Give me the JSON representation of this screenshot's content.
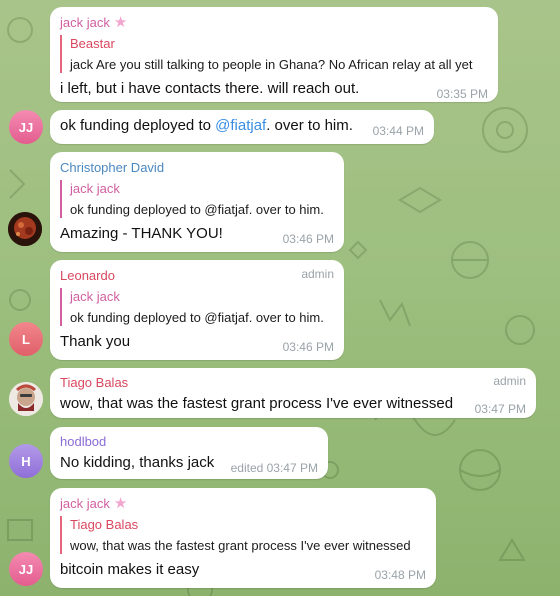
{
  "theme": {
    "accent": "#3a8ee6",
    "bubble_bg": "#ffffff",
    "wallpaper": "#9dbf7f"
  },
  "messages": [
    {
      "sender": "jack jack",
      "sender_badge": "star-icon",
      "reply_to": {
        "name": "Beastar",
        "text": "jack Are you still talking to people in Ghana? No African relay at all yet"
      },
      "text": "i left, but i have contacts there. will reach out.",
      "time": "03:35 PM"
    },
    {
      "avatar_initials": "JJ",
      "text_prefix": "ok funding deployed to ",
      "mention": "@fiatjaf",
      "text_suffix": ". over to him.",
      "time": "03:44 PM"
    },
    {
      "sender": "Christopher David",
      "reply_to": {
        "name": "jack jack",
        "text": "ok funding deployed to @fiatjaf. over to him."
      },
      "text": "Amazing - THANK YOU!",
      "time": "03:46 PM"
    },
    {
      "sender": "Leonardo",
      "role": "admin",
      "avatar_initials": "L",
      "reply_to": {
        "name": "jack jack",
        "text": "ok funding deployed to @fiatjaf. over to him."
      },
      "text": "Thank you",
      "time": "03:46 PM"
    },
    {
      "sender": "Tiago Balas",
      "role": "admin",
      "text": "wow, that was the fastest grant process I've ever witnessed",
      "time": "03:47 PM"
    },
    {
      "sender": "hodlbod",
      "avatar_initials": "H",
      "text": "No kidding, thanks jack",
      "time": "edited 03:47 PM"
    },
    {
      "sender": "jack jack",
      "sender_badge": "star-icon",
      "avatar_initials": "JJ",
      "reply_to": {
        "name": "Tiago Balas",
        "text": "wow, that was the fastest grant process I've ever witnessed"
      },
      "text": "bitcoin makes it easy",
      "time": "03:48 PM"
    }
  ]
}
